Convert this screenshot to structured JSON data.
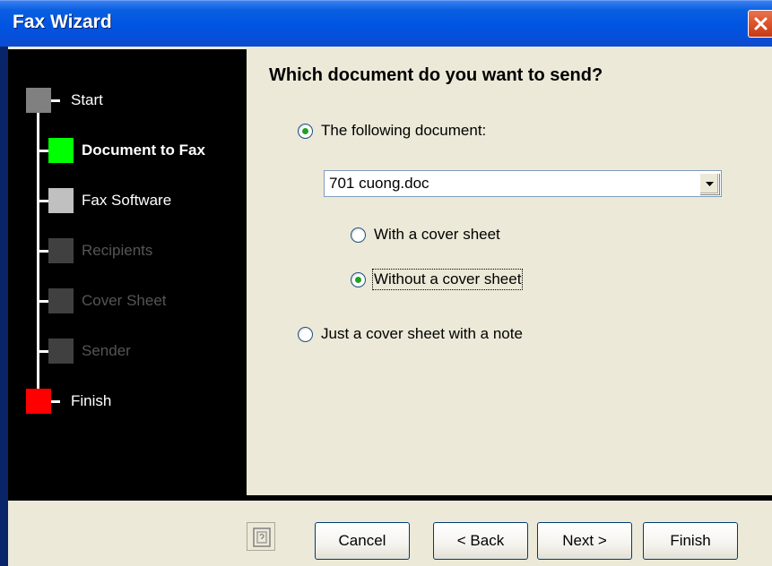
{
  "window": {
    "title": "Fax Wizard",
    "close_icon": "close-icon"
  },
  "steps": [
    {
      "label": "Start",
      "state": "completed",
      "color": "#808080"
    },
    {
      "label": "Document to Fax",
      "state": "current",
      "color": "#00ff00"
    },
    {
      "label": "Fax Software",
      "state": "upcoming",
      "color": "#c0c0c0"
    },
    {
      "label": "Recipients",
      "state": "disabled",
      "color": "#404040"
    },
    {
      "label": "Cover Sheet",
      "state": "disabled",
      "color": "#404040"
    },
    {
      "label": "Sender",
      "state": "disabled",
      "color": "#404040"
    },
    {
      "label": "Finish",
      "state": "end",
      "color": "#ff0000"
    }
  ],
  "content": {
    "heading": "Which document do you want to send?",
    "following_document": {
      "label": "The following document:",
      "checked": true
    },
    "document_select": {
      "value": "701 cuong.doc"
    },
    "with_cover": {
      "label": "With a cover sheet",
      "checked": false
    },
    "without_cover": {
      "label": "Without a cover sheet",
      "checked": true
    },
    "cover_only": {
      "label": "Just a cover sheet with a note",
      "checked": false
    }
  },
  "footer": {
    "help_icon": "help-icon",
    "cancel": "Cancel",
    "back": "< Back",
    "next": "Next >",
    "finish": "Finish"
  }
}
